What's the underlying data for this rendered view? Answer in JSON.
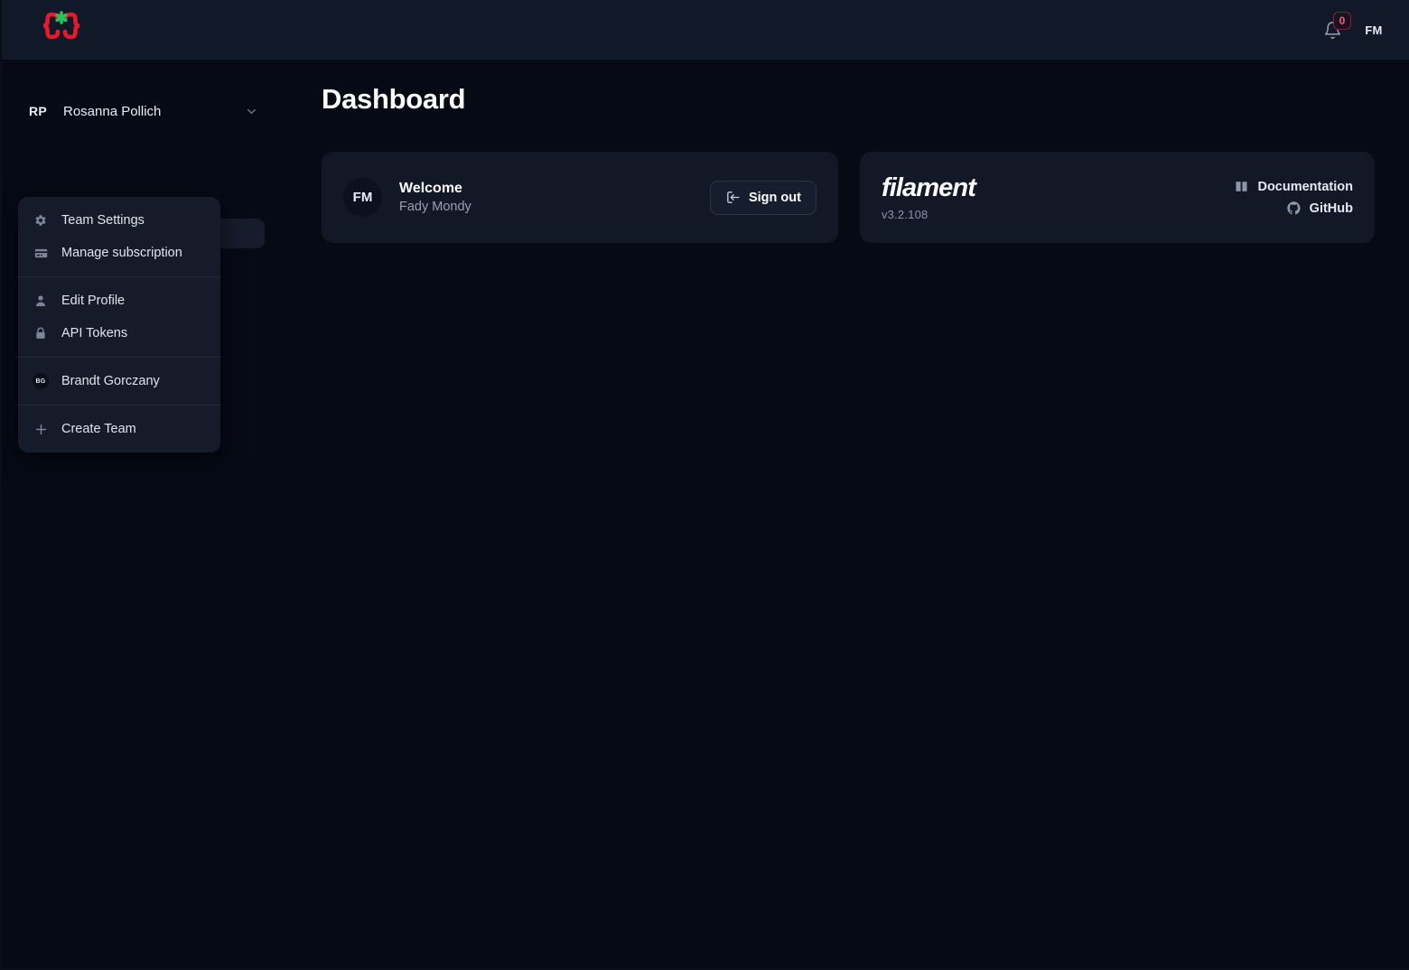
{
  "topbar": {
    "logo_name": "curly-brace-asterisk-logo",
    "notifications": {
      "icon": "bell-icon",
      "count": "0"
    },
    "user_avatar_initials": "FM"
  },
  "sidebar": {
    "team_selector": {
      "initials": "RP",
      "name": "Rosanna Pollich",
      "chevron": "chevron-down-icon"
    },
    "dropdown": {
      "groups": [
        {
          "items": [
            {
              "icon": "gear-icon",
              "label": "Team Settings"
            },
            {
              "icon": "credit-card-icon",
              "label": "Manage subscription"
            }
          ]
        },
        {
          "items": [
            {
              "icon": "user-icon",
              "label": "Edit Profile"
            },
            {
              "icon": "lock-icon",
              "label": "API Tokens"
            }
          ]
        },
        {
          "items": [
            {
              "icon": "team-avatar",
              "label": "Brandt Gorczany",
              "initials": "BG"
            }
          ]
        },
        {
          "items": [
            {
              "icon": "plus-icon",
              "label": "Create Team"
            }
          ]
        }
      ]
    }
  },
  "main": {
    "page_title": "Dashboard",
    "welcome_card": {
      "avatar_initials": "FM",
      "title": "Welcome",
      "subtitle": "Fady Mondy",
      "signout_label": "Sign out",
      "signout_icon": "logout-icon"
    },
    "filament_card": {
      "wordmark": "filament",
      "version": "v3.2.108",
      "links": [
        {
          "icon": "book-icon",
          "label": "Documentation"
        },
        {
          "icon": "github-icon",
          "label": "GitHub"
        }
      ]
    }
  },
  "colors": {
    "page_bg": "#060A15",
    "topbar_bg": "#111827",
    "card_bg": "#121826",
    "menu_bg": "#151B28",
    "logo_brace": "#e8192c",
    "logo_star": "#22c55e",
    "badge_text": "#f05a7a"
  }
}
